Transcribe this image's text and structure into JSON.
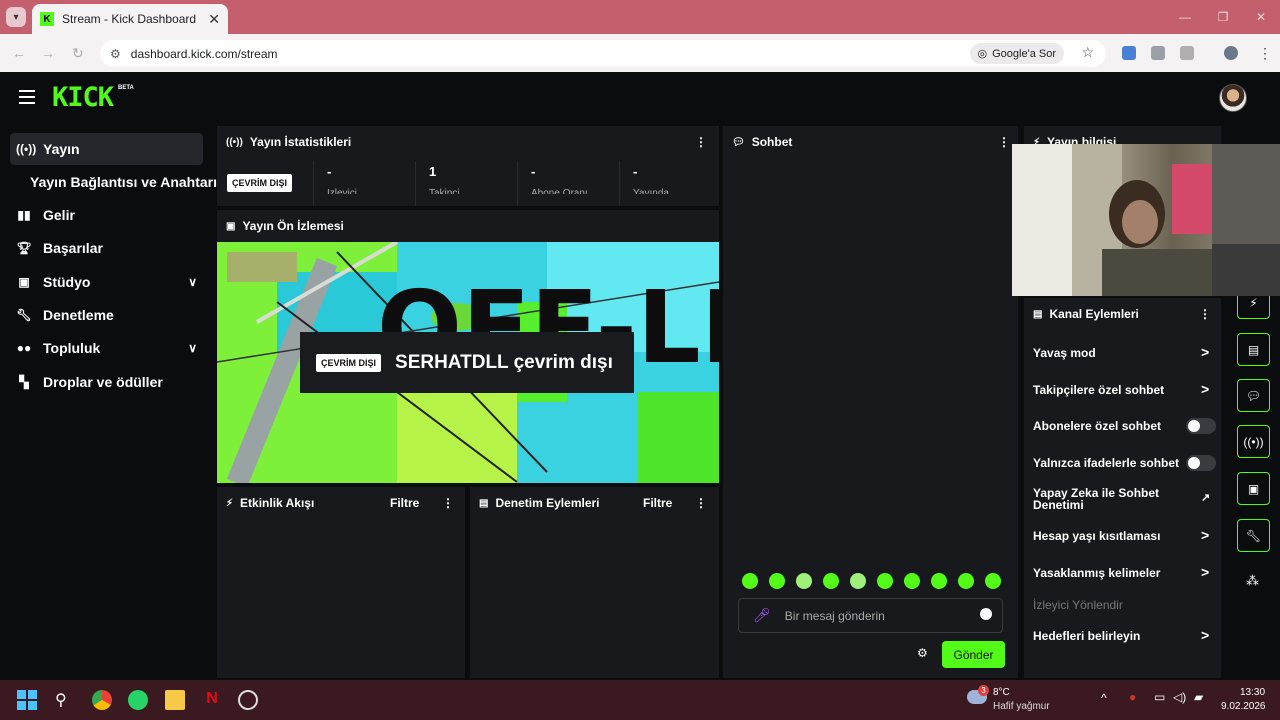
{
  "browser": {
    "tab_title": "Stream - Kick Dashboard",
    "tab_close": "✕",
    "url": "dashboard.kick.com/stream",
    "google_ask": "Google'a Sor",
    "window_controls": [
      "—",
      "❐",
      "✕"
    ]
  },
  "header": {
    "logo": "KICK",
    "beta": "BETA"
  },
  "sidebar": {
    "items": [
      {
        "icon": "broadcast-icon",
        "label": "Yayın",
        "active": true
      },
      {
        "icon": "",
        "label": "Yayın Bağlantısı ve Anahtarı"
      },
      {
        "icon": "revenue-icon",
        "label": "Gelir"
      },
      {
        "icon": "trophy-icon",
        "label": "Başarılar"
      },
      {
        "icon": "studio-icon",
        "label": "Stüdyo",
        "expandable": true
      },
      {
        "icon": "wrench-icon",
        "label": "Denetleme"
      },
      {
        "icon": "community-icon",
        "label": "Topluluk",
        "expandable": true
      },
      {
        "icon": "drops-icon",
        "label": "Droplar ve ödüller"
      }
    ]
  },
  "stats_panel": {
    "title": "Yayın İstatistikleri",
    "status_badge": "ÇEVRİM DIŞI",
    "stats": [
      {
        "value": "-",
        "label": "İzleyici"
      },
      {
        "value": "1",
        "label": "Takipçi"
      },
      {
        "value": "-",
        "label": "Abone Oranı"
      },
      {
        "value": "-",
        "label": "Yayında"
      }
    ]
  },
  "preview_panel": {
    "title": "Yayın Ön İzlemesi",
    "offline_text": "OFF-LINE",
    "badge": "ÇEVRİM DIŞI",
    "status_text": "SERHATDLL çevrim dışı"
  },
  "activity_panel": {
    "title": "Etkinlik Akışı",
    "filter": "Filtre"
  },
  "moderation_panel": {
    "title": "Denetim Eylemleri",
    "filter": "Filtre"
  },
  "chat_panel": {
    "title": "Sohbet",
    "input_placeholder": "Bir mesaj gönderin",
    "send_label": "Gönder"
  },
  "stream_info_panel": {
    "title": "Yayın bilgisi"
  },
  "channel_actions": {
    "title": "Kanal Eylemleri",
    "items": [
      {
        "label": "Yavaş mod",
        "control": "chevron"
      },
      {
        "label": "Takipçilere özel sohbet",
        "control": "chevron"
      },
      {
        "label": "Abonelere özel sohbet",
        "control": "toggle",
        "on": false
      },
      {
        "label": "Yalnızca ifadelerle sohbet",
        "control": "toggle",
        "on": false
      },
      {
        "label": "Yapay Zeka ile Sohbet Denetimi",
        "control": "external"
      },
      {
        "label": "Hesap yaşı kısıtlaması",
        "control": "chevron"
      },
      {
        "label": "Yasaklanmış kelimeler",
        "control": "chevron"
      }
    ],
    "section_label": "İzleyici Yönlendir",
    "targets": "Hedefleri belirleyin"
  },
  "taskbar": {
    "weather_badge": "3",
    "temperature": "8°C",
    "weather": "Hafif yağmur",
    "time": "13:30",
    "date": "9.02.2026"
  },
  "colors": {
    "accent": "#53fc18",
    "panel": "#18191d",
    "background": "#0b0c0e"
  }
}
